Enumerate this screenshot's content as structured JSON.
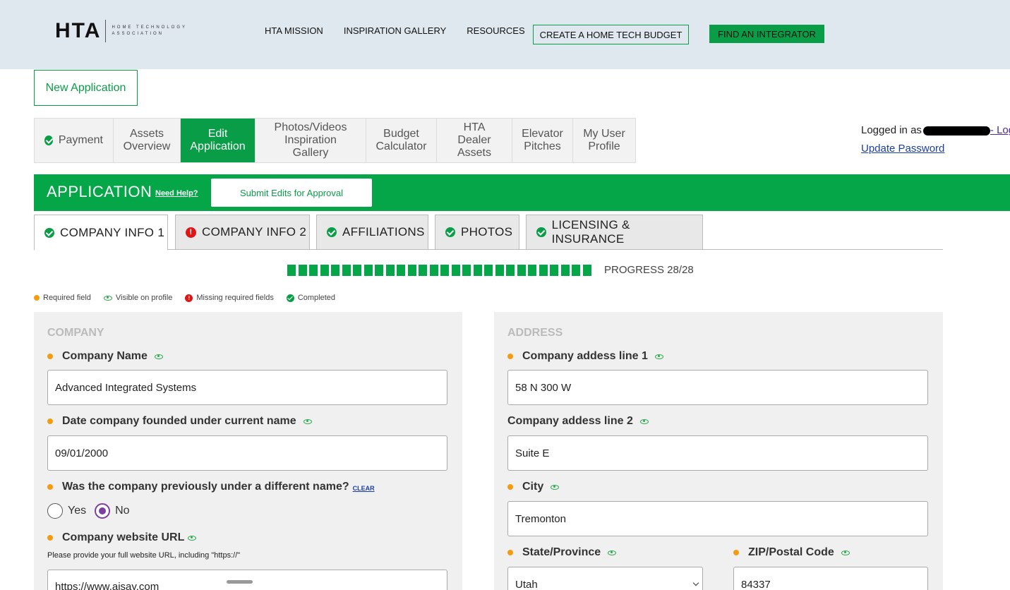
{
  "header": {
    "logo_mark": "HTA",
    "logo_sub": "HOME TECHNOLOGY ASSOCIATION",
    "nav": [
      "HTA MISSION",
      "INSPIRATION GALLERY",
      "RESOURCES"
    ],
    "budget_button": "CREATE A HOME TECH BUDGET",
    "integrator_button": "FIND AN INTEGRATOR"
  },
  "new_application": "New Application",
  "subnav": [
    {
      "label": "Payment",
      "checked": true
    },
    {
      "label": "Assets Overview"
    },
    {
      "label": "Edit Application",
      "active": true
    },
    {
      "label": "Photos/Videos Inspiration Gallery"
    },
    {
      "label": "Budget Calculator"
    },
    {
      "label": "HTA Dealer Assets"
    },
    {
      "label": "Elevator Pitches"
    },
    {
      "label": "My User Profile"
    }
  ],
  "login": {
    "prefix": "Logged in as",
    "logout": "- Log",
    "update_password": "Update Password"
  },
  "appbar": {
    "title": "APPLICATION",
    "help": "Need Help?",
    "submit": "Submit Edits for Approval"
  },
  "tabs": [
    {
      "label": "COMPANY INFO 1",
      "status": "complete",
      "active": true
    },
    {
      "label": "COMPANY INFO 2",
      "status": "missing"
    },
    {
      "label": "AFFILIATIONS",
      "status": "complete"
    },
    {
      "label": "PHOTOS",
      "status": "complete"
    },
    {
      "label": "LICENSING & INSURANCE",
      "status": "complete"
    }
  ],
  "progress": {
    "text": "PROGRESS 28/28",
    "done": 28,
    "total": 28
  },
  "legend": {
    "required": "Required field",
    "visible": "Visible on profile",
    "missing": "Missing required fields",
    "completed": "Completed"
  },
  "company": {
    "heading": "COMPANY",
    "name_label": "Company Name",
    "name_value": "Advanced Integrated Systems",
    "founded_label": "Date company founded under current name",
    "founded_value": "09/01/2000",
    "prev_name_label": "Was the company previously under a different name?",
    "clear": "CLEAR",
    "yes": "Yes",
    "no": "No",
    "selected": "No",
    "website_label": "Company website URL",
    "website_hint": "Please provide your full website URL, including \"https://\"",
    "website_value": "https://www.aisay.com"
  },
  "address": {
    "heading": "ADDRESS",
    "line1_label": "Company addess line 1",
    "line1_value": "58 N 300 W",
    "line2_label": "Company addess line 2",
    "line2_value": "Suite E",
    "city_label": "City",
    "city_value": "Tremonton",
    "state_label": "State/Province",
    "state_value": "Utah",
    "zip_label": "ZIP/Postal Code",
    "zip_value": "84337"
  }
}
